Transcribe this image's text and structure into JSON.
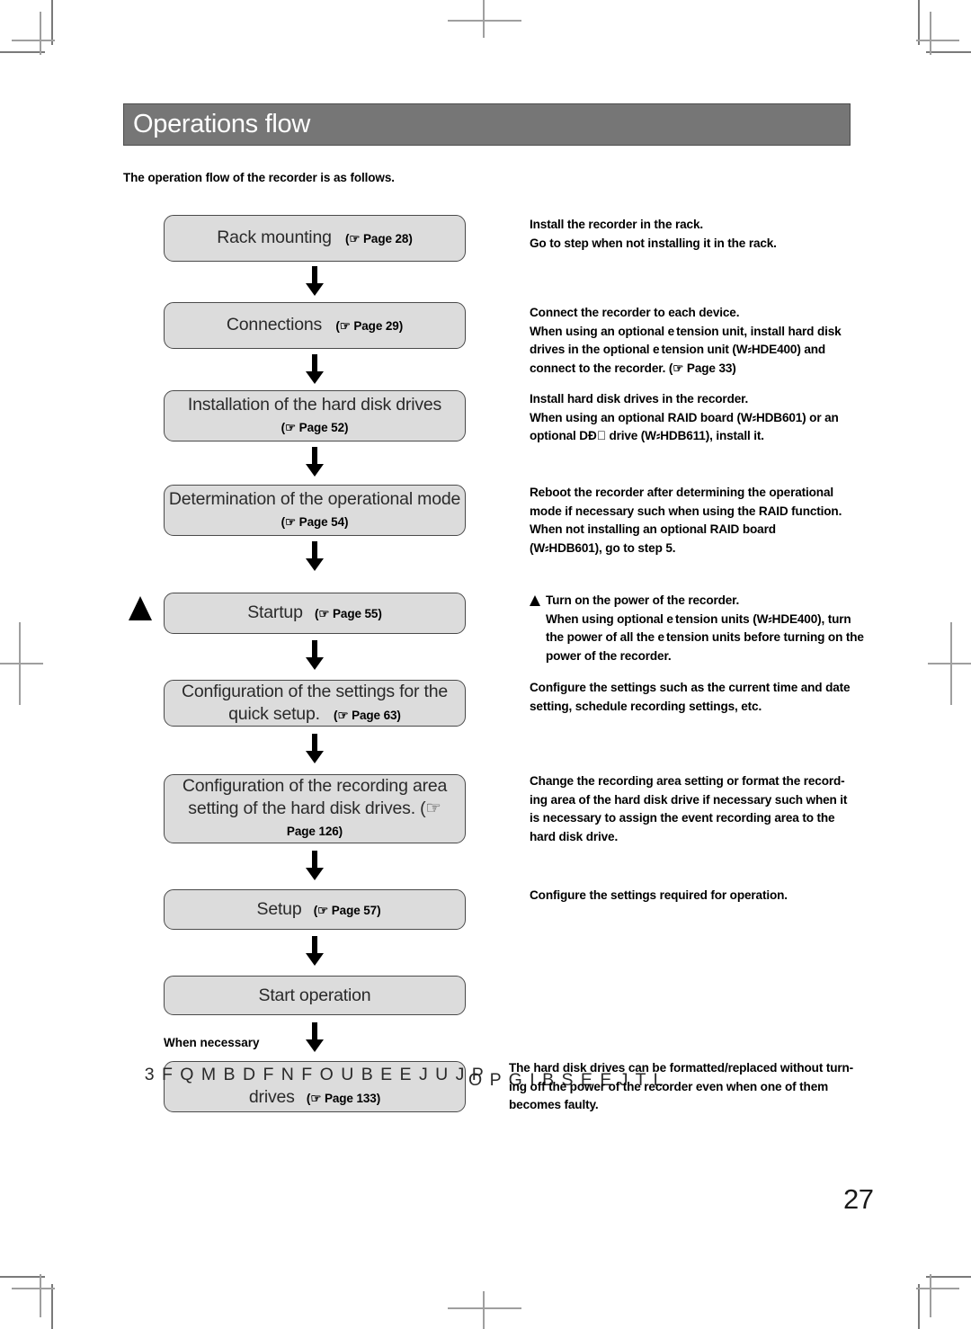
{
  "header": {
    "title": "Operations flow"
  },
  "intro": "The operation flow of the recorder is as follows.",
  "page_number": "27",
  "when_necessary_label": "When necessary",
  "icons": {
    "hand_pointer": "☞",
    "down_arrow": "down-arrow-icon",
    "up_triangle": "up-triangle-marker"
  },
  "colors": {
    "header_band": "#767676",
    "header_text": "#ffffff",
    "box_fill": "#dcdcdc",
    "box_border": "#4a4a4a",
    "box_text": "#2a2a2a",
    "body_text": "#000000",
    "regmark": "#7a7a7a"
  },
  "flow": {
    "boxes": [
      {
        "id": "rack-mounting",
        "lines": [
          "Rack mounting"
        ],
        "ref": "(☞ Page 28)",
        "ref_inline": true
      },
      {
        "id": "connections",
        "lines": [
          "Connections"
        ],
        "ref": "(☞ Page 29)",
        "ref_inline": true
      },
      {
        "id": "installation-hard-disk-drives",
        "lines": [
          "Installation of the hard disk drives"
        ],
        "ref": "(☞ Page 52)",
        "ref_inline": false
      },
      {
        "id": "determination-operational-mode",
        "lines": [
          "Determination of the operational mode"
        ],
        "ref": "(☞ Page 54)",
        "ref_inline": false
      },
      {
        "id": "startup",
        "lines": [
          "Startup"
        ],
        "ref": "(☞ Page 55)",
        "ref_inline": true
      },
      {
        "id": "quick-setup-configuration",
        "lines": [
          "Configuration of the settings for the",
          "quick setup."
        ],
        "ref": "(☞ Page 63)",
        "ref_inline": true
      },
      {
        "id": "recording-area-configuration",
        "lines": [
          "Configuration of the recording area",
          "setting of the hard disk drives.    (☞"
        ],
        "ref": "Page 126)",
        "ref_inline": false
      },
      {
        "id": "setup",
        "lines": [
          "Setup"
        ],
        "ref": "(☞ Page 57)",
        "ref_inline": true
      },
      {
        "id": "start-operation",
        "lines": [
          "Start operation"
        ],
        "ref": "",
        "ref_inline": true
      },
      {
        "id": "replacement-addition-hard-disk-drives",
        "lines": [
          "3 F Q M B D F N F O U   B E E J U J P",
          "drives"
        ],
        "ref": "(☞ Page 133)",
        "ref_inline": true
      }
    ],
    "garble_overflow": "O   P G   I B S E   E J T L"
  },
  "notes": [
    {
      "id": "note-rack-mounting",
      "triangle": false,
      "lines": [
        "Install the recorder in the rack.",
        "Go to step     when not installing it in the rack."
      ]
    },
    {
      "id": "note-connections",
      "triangle": false,
      "lines": [
        "Connect the recorder to each device.",
        "When using an optional e tension unit, install hard disk",
        "drives in the optional e tension unit (W⸗HDE400) and",
        "connect to the recorder. (☞ Page 33)"
      ]
    },
    {
      "id": "note-installation",
      "triangle": false,
      "lines": [
        "Install hard disk drives in the recorder.",
        "When using an optional RAID board (W⸗HDB601) or an",
        "optional DƉ⃝ drive (W⸗HDB611), install it."
      ]
    },
    {
      "id": "note-operational-mode",
      "triangle": false,
      "lines": [
        "Reboot the recorder after determining the operational",
        "mode if necessary such when using the RAID function.",
        "When not installing an optional RAID board",
        "(W⸗HDB601), go to step 5."
      ]
    },
    {
      "id": "note-startup",
      "triangle": true,
      "lines": [
        "Turn on the power of the recorder.",
        "When using optional e tension units (W⸗HDE400), turn",
        "the power of all the e tension units before turning on the",
        "power of the recorder."
      ]
    },
    {
      "id": "note-quick-setup",
      "triangle": false,
      "lines": [
        "Configure the settings such as the current time and date",
        "setting, schedule recording settings, etc."
      ]
    },
    {
      "id": "note-recording-area",
      "triangle": false,
      "lines": [
        "Change the recording area setting or format the record-",
        "ing area of the hard disk drive if necessary such when it",
        "is necessary to assign the event recording area to the",
        "hard disk drive."
      ]
    },
    {
      "id": "note-setup",
      "triangle": false,
      "lines": [
        "Configure the settings required for operation."
      ]
    },
    {
      "id": "note-replacement",
      "triangle": false,
      "lines": [
        "The hard disk drives can be formatted/replaced without turn-",
        "ing off the power of the recorder even when one of them",
        "becomes faulty."
      ]
    }
  ]
}
